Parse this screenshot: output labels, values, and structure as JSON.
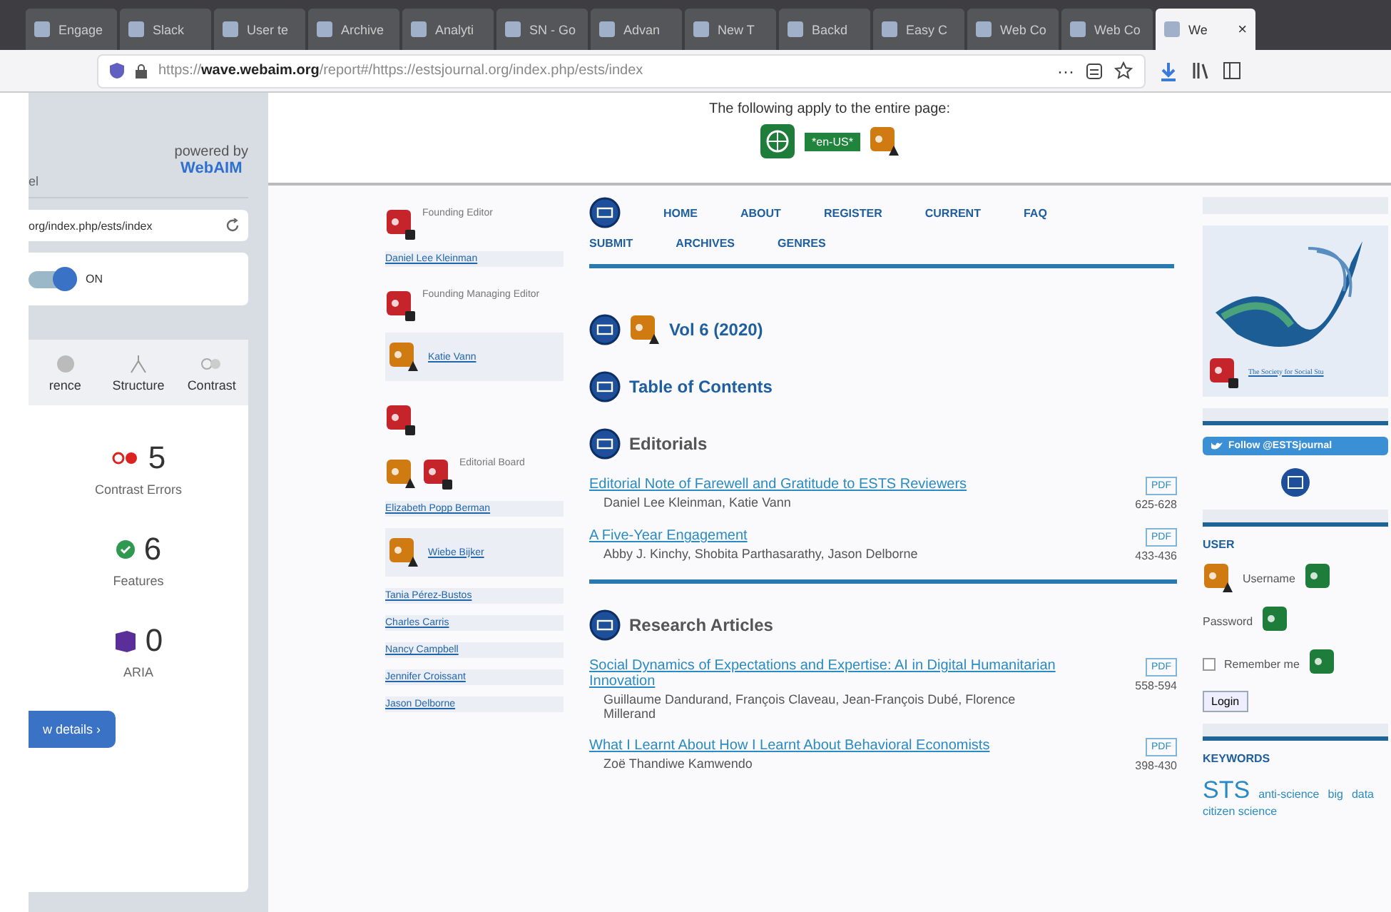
{
  "browser": {
    "tabs": [
      {
        "label": "Engage",
        "selected": false
      },
      {
        "label": "Slack",
        "selected": false
      },
      {
        "label": "User te",
        "selected": false
      },
      {
        "label": "Archive",
        "selected": false
      },
      {
        "label": "Analyti",
        "selected": false
      },
      {
        "label": "SN - Go",
        "selected": false
      },
      {
        "label": "Advan",
        "selected": false
      },
      {
        "label": "New T",
        "selected": false
      },
      {
        "label": "Backd",
        "selected": false
      },
      {
        "label": "Easy C",
        "selected": false
      },
      {
        "label": "Web Co",
        "selected": false
      },
      {
        "label": "Web Co",
        "selected": false
      },
      {
        "label": "We",
        "selected": true,
        "close": "×"
      }
    ],
    "url": "https://**wave.webaim.org**/report#/https://estsjournal.org/index.php/ests/index",
    "more": "···"
  },
  "wave": {
    "cut_label": "el",
    "powered_by": "powered by",
    "brand": "WebAIM",
    "url_field": "org/index.php/ests/index",
    "toggle": {
      "label": "ON",
      "on": true
    },
    "view_tabs": [
      {
        "label": "rence",
        "selected": false
      },
      {
        "label": "Structure",
        "selected": false
      },
      {
        "label": "Contrast",
        "selected": false
      }
    ],
    "stats": [
      {
        "kind": "contrast",
        "count": "5",
        "label": "Contrast Errors"
      },
      {
        "kind": "feature",
        "count": "6",
        "label": "Features"
      },
      {
        "kind": "aria",
        "count": "0",
        "label": "ARIA"
      }
    ],
    "details_button": "w details ›"
  },
  "page": {
    "banner": {
      "text": "The following apply to the entire page:",
      "lang": "*en-US*"
    },
    "editors": [
      {
        "kind": "role",
        "markers": [
          {
            "kind": "error"
          }
        ],
        "text": "Founding Editor"
      },
      {
        "kind": "link",
        "text": "Daniel Lee Kleinman"
      },
      {
        "kind": "role",
        "markers": [
          {
            "kind": "error"
          }
        ],
        "text": "Founding Managing Editor"
      },
      {
        "kind": "iconlink",
        "markers": [
          {
            "kind": "alert"
          }
        ],
        "text": "Katie Vann"
      },
      {
        "kind": "role",
        "markers": [
          {
            "kind": "error"
          }
        ]
      },
      {
        "kind": "role",
        "markers": [
          {
            "kind": "alert"
          },
          {
            "kind": "error"
          }
        ],
        "text": "Editorial Board"
      },
      {
        "kind": "link",
        "text": "Elizabeth Popp Berman"
      },
      {
        "kind": "iconlink",
        "markers": [
          {
            "kind": "alert"
          }
        ],
        "text": "Wiebe Bijker"
      },
      {
        "kind": "link",
        "text": "Tania Pérez-Bustos"
      },
      {
        "kind": "link",
        "text": "Charles Carris"
      },
      {
        "kind": "link",
        "text": "Nancy Campbell"
      },
      {
        "kind": "link",
        "text": "Jennifer Croissant"
      },
      {
        "kind": "link",
        "text": "Jason Delborne"
      }
    ],
    "nav": [
      "HOME",
      "ABOUT",
      "REGISTER",
      "CURRENT",
      "FAQ",
      "SUBMIT",
      "ARCHIVES",
      "GENRES"
    ],
    "sections": [
      {
        "kind": "heading",
        "text": "Vol 6 (2020)",
        "alert": true,
        "link": true
      },
      {
        "kind": "heading",
        "text": "Table of Contents",
        "alert": false,
        "link": true
      },
      {
        "kind": "heading",
        "text": "Editorials",
        "alert": false,
        "link": false
      },
      {
        "kind": "article",
        "title": "Editorial Note of Farewell and Gratitude to ESTS Reviewers",
        "authors": "Daniel Lee Kleinman, Katie Vann",
        "pdf": "PDF",
        "pages": "625-628"
      },
      {
        "kind": "article",
        "title": "A Five-Year Engagement",
        "authors": "Abby J. Kinchy, Shobita Parthasarathy, Jason Delborne",
        "pdf": "PDF",
        "pages": "433-436"
      },
      {
        "kind": "rule"
      },
      {
        "kind": "heading",
        "text": "Research Articles",
        "alert": false,
        "link": false
      },
      {
        "kind": "article",
        "title": "Social Dynamics of Expectations and Expertise: AI in Digital Humanitarian Innovation",
        "authors": "Guillaume Dandurand, François Claveau, Jean-François Dubé, Florence Millerand",
        "pdf": "PDF",
        "pages": "558-594"
      },
      {
        "kind": "article",
        "title": "What I Learnt About How I Learnt About Behavioral Economists",
        "authors": "Zoë Thandiwe Kamwendo",
        "pdf": "PDF",
        "pages": "398-430"
      }
    ],
    "sidebar": {
      "society_link": "The Society for Social Stu",
      "twitter": "Follow @ESTSjournal",
      "user_heading": "USER",
      "username": "Username",
      "password": "Password",
      "remember": {
        "label": "Remember me",
        "checked": false
      },
      "login": "Login",
      "keywords_heading": "KEYWORDS",
      "keywords": [
        {
          "text": "STS",
          "big": true
        },
        {
          "text": "anti-science",
          "big": false
        },
        {
          "text": "big",
          "big": false
        },
        {
          "text": "data",
          "big": false
        },
        {
          "text": "citizen science",
          "big": false
        }
      ]
    }
  }
}
